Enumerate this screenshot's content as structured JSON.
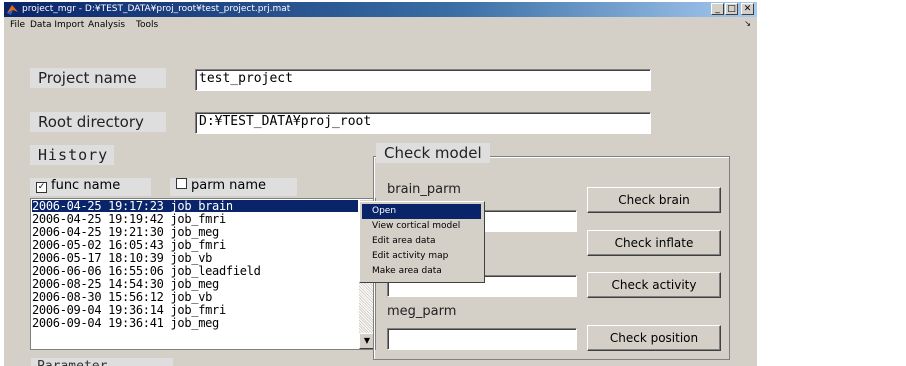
{
  "window": {
    "title": "project_mgr - D:¥TEST_DATA¥proj_root¥test_project.prj.mat",
    "controls": [
      "_",
      "□",
      "✕"
    ]
  },
  "menu": {
    "items": [
      {
        "label": "File"
      },
      {
        "label": "Data Import"
      },
      {
        "label": "Analysis"
      },
      {
        "label": "Tools"
      }
    ],
    "dock_arrow": "↘"
  },
  "project": {
    "name_label": "Project name",
    "name_value": "test_project",
    "root_label": "Root directory",
    "root_value": "D:¥TEST_DATA¥proj_root"
  },
  "history": {
    "title": "History",
    "func_name_label": "func name",
    "func_name_checked": true,
    "parm_name_label": "parm name",
    "parm_name_checked": false,
    "rows": [
      "2006-04-25 19:17:23 job_brain",
      "2006-04-25 19:19:42 job_fmri",
      "2006-04-25 19:21:30 job_meg",
      "2006-05-02 16:05:43 job_fmri",
      "2006-05-17 18:10:39 job_vb",
      "2006-06-06 16:55:06 job_leadfield",
      "2006-08-25 14:54:30 job_meg",
      "2006-08-30 15:56:12 job_vb",
      "2006-09-04 19:36:14 job_fmri",
      "2006-09-04 19:36:41 job_meg"
    ],
    "selected_index": 0
  },
  "context_menu": {
    "items": [
      "Open",
      "View cortical model",
      "Edit area data",
      "Edit activity map",
      "Make area data"
    ],
    "selected_index": 0
  },
  "check_model": {
    "title": "Check model",
    "brain_parm_label": "brain_parm",
    "meg_parm_label": "meg_parm",
    "buttons": {
      "check_brain": "Check brain",
      "check_inflate": "Check inflate",
      "check_activity": "Check activity",
      "check_position": "Check position"
    }
  },
  "parameter": {
    "title": "Parameter"
  }
}
